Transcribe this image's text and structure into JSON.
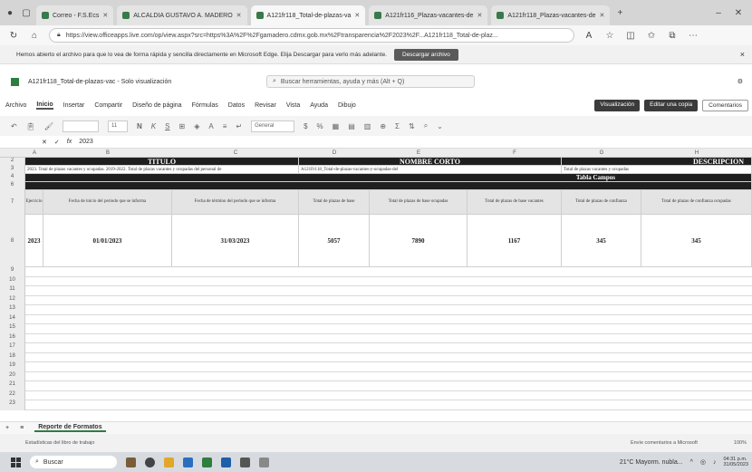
{
  "browser": {
    "tabs": [
      {
        "label": "Correo - F.S.Ecs",
        "active": false
      },
      {
        "label": "ALCALDIA GUSTAVO A. MADERO",
        "active": false
      },
      {
        "label": "A121fr118_Total-de-plazas-va",
        "active": true
      },
      {
        "label": "A121fr116_Plazas-vacantes-de",
        "active": false
      },
      {
        "label": "A121fr118_Plazas-vacantes-de",
        "active": false
      }
    ],
    "new_tab": "+",
    "url": "https://view.officeapps.live.com/op/view.aspx?src=https%3A%2F%2Fgamadero.cdmx.gob.mx%2Ftransparencia%2F2023%2F...A121fr118_Total-de-plaz...",
    "info_message": "Hemos abierto el archivo para que lo vea de forma rápida y sencilla directamente en Microsoft Edge. Elija Descargar para verlo más adelante.",
    "download_label": "Descargar archivo",
    "close_info": "×"
  },
  "excel": {
    "file_title": "A121fr118_Total-de-plazas-vac - Solo visualización",
    "search_placeholder": "Buscar herramientas, ayuda y más (Alt + Q)",
    "menu": [
      "Archivo",
      "Inicio",
      "Insertar",
      "Compartir",
      "Diseño de página",
      "Fórmulas",
      "Datos",
      "Revisar",
      "Vista",
      "Ayuda",
      "Dibujo"
    ],
    "active_menu": "Inicio",
    "viewing_label": "Visualización",
    "edit_copy_label": "Editar una copia",
    "comments_label": "Comentarios",
    "ribbon_font_size": "11",
    "ribbon_format": "General",
    "cell_ref": "",
    "formula_fx": "fx",
    "formula_value": "2023",
    "col_letters": [
      "A",
      "B",
      "C",
      "D",
      "E",
      "F",
      "G",
      "H"
    ],
    "row_numbers": [
      "2",
      "3",
      "4",
      "6",
      "7",
      "8",
      "9",
      "10",
      "11",
      "12",
      "13",
      "14",
      "15",
      "16",
      "17",
      "18",
      "19",
      "20",
      "21",
      "22",
      "23"
    ],
    "sheet": {
      "title_header": "TITULO",
      "short_name_header": "NOMBRE CORTO",
      "description_header": "DESCRIPCION",
      "title_value": "2023. Total de plazas vacantes y ocupadas. 2019-2022. Total de plazas vacantes y ocupadas del personal de",
      "short_name_value": "A121Fr118_Total-de-plazas-vacantes-y-ocupadas-del",
      "description_value": "Total de plazas vacantes y ocupadas",
      "tabla_campos": "Tabla Campos",
      "columns": [
        "Ejercicio",
        "Fecha de inicio del periodo que se informa",
        "Fecha de término del periodo que se informa",
        "Total de plazas de base",
        "Total de plazas de base ocupadas",
        "Total de plazas de base vacantes",
        "Total de plazas de confianza",
        "Total de plazas de confianza ocupadas"
      ],
      "row": [
        "2023",
        "01/01/2023",
        "31/03/2023",
        "5057",
        "7890",
        "1167",
        "345",
        "345"
      ]
    },
    "sheet_tab": "Reporte de Formatos",
    "status_left": "Estadísticas del libro de trabajo",
    "status_right": "Envíe comentarios a Microsoft",
    "zoom": "100%"
  },
  "taskbar": {
    "search_label": "Buscar",
    "weather": "21°C  Mayorm. nubla...",
    "time": "04:31 p.m.",
    "date": "31/05/2023"
  },
  "colors": {
    "dark_header": "#1f1f1f",
    "download_btn": "#5a5a5a"
  }
}
